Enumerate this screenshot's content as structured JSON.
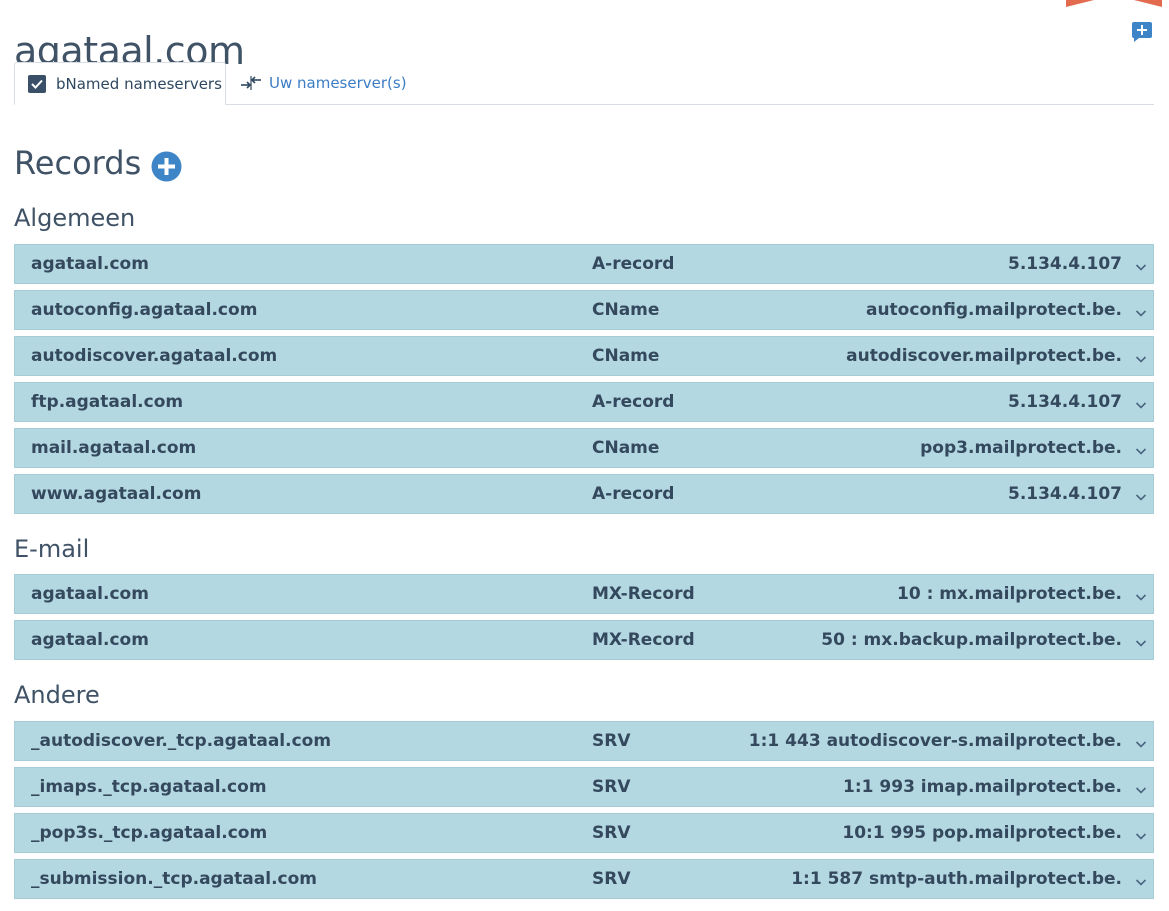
{
  "domain": "agataal.com",
  "tabs": {
    "active_label": "bNamed nameservers",
    "inactive_label": "Uw nameserver(s)"
  },
  "records_title": "Records",
  "sections": [
    {
      "title": "Algemeen",
      "rows": [
        {
          "name": "agataal.com",
          "type": "A-record",
          "value": "5.134.4.107"
        },
        {
          "name": "autoconfig.agataal.com",
          "type": "CName",
          "value": "autoconfig.mailprotect.be."
        },
        {
          "name": "autodiscover.agataal.com",
          "type": "CName",
          "value": "autodiscover.mailprotect.be."
        },
        {
          "name": "ftp.agataal.com",
          "type": "A-record",
          "value": "5.134.4.107"
        },
        {
          "name": "mail.agataal.com",
          "type": "CName",
          "value": "pop3.mailprotect.be."
        },
        {
          "name": "www.agataal.com",
          "type": "A-record",
          "value": "5.134.4.107"
        }
      ]
    },
    {
      "title": "E-mail",
      "rows": [
        {
          "name": "agataal.com",
          "type": "MX-Record",
          "value": "10 : mx.mailprotect.be."
        },
        {
          "name": "agataal.com",
          "type": "MX-Record",
          "value": "50 : mx.backup.mailprotect.be."
        }
      ]
    },
    {
      "title": "Andere",
      "rows": [
        {
          "name": "_autodiscover._tcp.agataal.com",
          "type": "SRV",
          "value": "1:1 443 autodiscover-s.mailprotect.be."
        },
        {
          "name": "_imaps._tcp.agataal.com",
          "type": "SRV",
          "value": "1:1 993 imap.mailprotect.be."
        },
        {
          "name": "_pop3s._tcp.agataal.com",
          "type": "SRV",
          "value": "10:1 995 pop.mailprotect.be."
        },
        {
          "name": "_submission._tcp.agataal.com",
          "type": "SRV",
          "value": "1:1 587 smtp-auth.mailprotect.be."
        }
      ]
    }
  ],
  "icons": {
    "comment": "add-comment-icon",
    "checkbox": "checkbox-checked-icon",
    "swap": "swap-arrows-icon",
    "add": "plus-circle-icon",
    "chevron": "chevron-down-icon"
  },
  "colors": {
    "row_background": "#b4d8e1",
    "accent_blue": "#3c7dc4",
    "add_button": "#3d85c6",
    "corner_accent": "#e26a4e"
  }
}
